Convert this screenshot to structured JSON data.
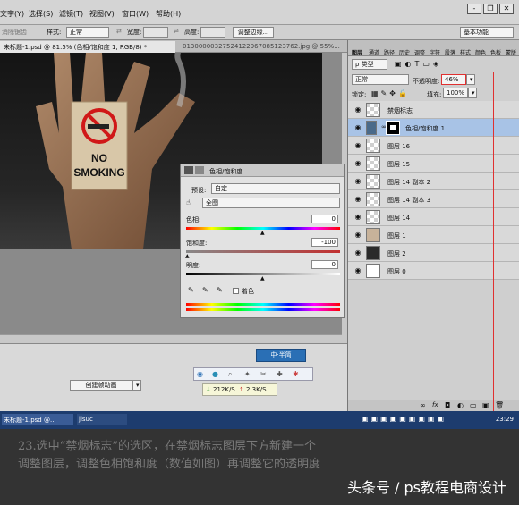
{
  "menubar": {
    "items": [
      "文字(Y)",
      "选择(S)",
      "滤镜(T)",
      "视图(V)",
      "窗口(W)",
      "帮助(H)"
    ],
    "win_min": "-",
    "win_restore": "❐",
    "win_close": "✕"
  },
  "options": {
    "clear_aliasing": "消除锯齿",
    "style_label": "样式:",
    "style_value": "正常",
    "width_label": "宽度:",
    "height_label": "高度:",
    "refine_edge": "调整边缘...",
    "workspace": "基本功能"
  },
  "doc_tabs": {
    "active": "未标题-1.psd @ 81.5% (色相/饱和度 1, RGB/8) *",
    "other": "01300000327524122967085123762.jpg @ 55%..."
  },
  "photo": {
    "sign_text_line1": "NO",
    "sign_text_line2": "SMOKING"
  },
  "adjustments": {
    "header_title": "色相/饱和度",
    "preset_label": "预设:",
    "preset_value": "自定",
    "channel_value": "全图",
    "hue_label": "色相:",
    "hue_value": "0",
    "saturation_label": "饱和度:",
    "saturation_value": "-100",
    "lightness_label": "明度:",
    "lightness_value": "0",
    "colorize_label": "着色"
  },
  "bottom": {
    "create_animation": "创建帧动画",
    "ime_label": "中·半简"
  },
  "network": {
    "down": "212K/S",
    "up": "2.3K/S"
  },
  "layers": {
    "tabs": [
      "图层",
      "通道",
      "路径",
      "历史",
      "调整",
      "字符",
      "段落",
      "样式",
      "颜色",
      "色板",
      "蒙版"
    ],
    "filter_label": "ρ 类型",
    "blend_mode": "正常",
    "opacity_label": "不透明度:",
    "opacity_value": "46%",
    "lock_label": "锁定:",
    "fill_label": "填充:",
    "fill_value": "100%",
    "items": [
      {
        "name": "禁烟标志"
      },
      {
        "name": "色相/饱和度 1"
      },
      {
        "name": "图层 16"
      },
      {
        "name": "图层 15"
      },
      {
        "name": "图层 14 副本 2"
      },
      {
        "name": "图层 14 副本 3"
      },
      {
        "name": "图层 14"
      },
      {
        "name": "图层 1"
      },
      {
        "name": "图层 2"
      },
      {
        "name": "图层 0"
      }
    ],
    "footer_icons": [
      "link-icon",
      "fx-icon",
      "mask-icon",
      "adjustment-icon",
      "folder-icon",
      "new-layer-icon",
      "trash-icon"
    ]
  },
  "taskbar": {
    "item1": "未标题-1.psd @...",
    "item2": "jisuc",
    "time": "23:29"
  },
  "caption": {
    "line1": "23.选中“禁烟标志”的选区，在禁烟标志图层下方新建一个",
    "line2": "调整图层，调整色相饱和度（数值如图）再调整它的透明度",
    "watermark": "头条号 / ps教程电商设计"
  },
  "colors": {
    "accent_red": "#e03030",
    "selection_blue": "#a8c3e6"
  }
}
